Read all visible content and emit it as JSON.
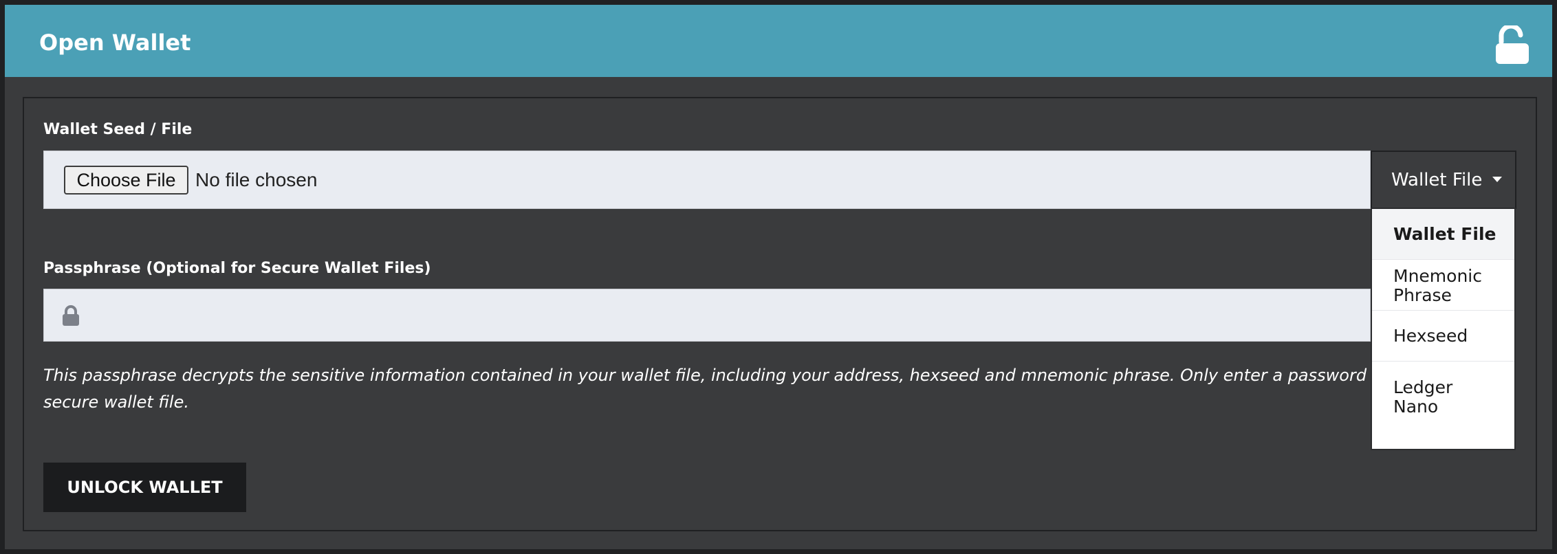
{
  "header": {
    "title": "Open Wallet",
    "lock_icon": "unlocked-padlock-icon"
  },
  "wallet_seed": {
    "label": "Wallet Seed / File",
    "choose_button": "Choose File",
    "file_status": "No file chosen",
    "type_select": {
      "selected": "Wallet File",
      "options": [
        {
          "line1": "Wallet File",
          "line2": ""
        },
        {
          "line1": "Mnemonic",
          "line2": "Phrase"
        },
        {
          "line1": "Hexseed",
          "line2": ""
        },
        {
          "line1": "Ledger",
          "line2": "Nano"
        }
      ]
    }
  },
  "passphrase": {
    "label": "Passphrase (Optional for Secure Wallet Files)",
    "value": "",
    "lock_icon": "padlock-icon",
    "help_line1": "This passphrase decrypts the sensitive information contained in your wallet file, including your address, hexseed and mnemonic phrase. Only enter a password if you",
    "help_line2": "secure wallet file."
  },
  "actions": {
    "unlock": "UNLOCK WALLET"
  },
  "colors": {
    "header": "#4ba0b6",
    "background": "#3a3b3d",
    "input": "#e9ecf2",
    "button": "#1b1c1e"
  }
}
